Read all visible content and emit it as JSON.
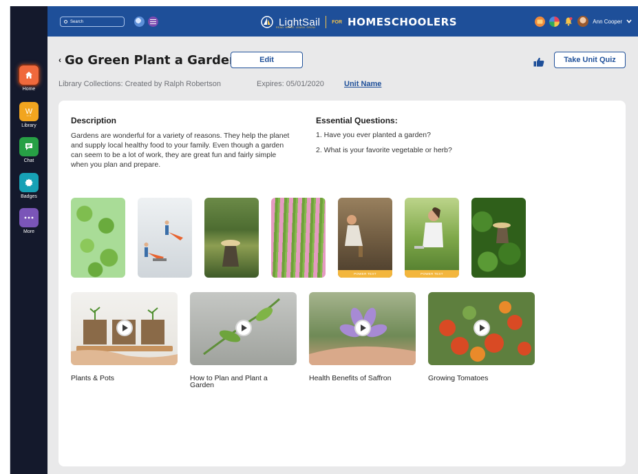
{
  "sidebar": {
    "items": [
      {
        "label": "Home",
        "icon": "home-icon",
        "color": "#f0693c"
      },
      {
        "label": "Library",
        "icon": "library-w-icon",
        "color": "#f2a51f"
      },
      {
        "label": "Chat",
        "icon": "chat-icon",
        "color": "#27a045"
      },
      {
        "label": "Badges",
        "icon": "badge-icon",
        "color": "#17a1b5"
      },
      {
        "label": "More",
        "icon": "more-dots-icon",
        "color": "#7a55b8"
      }
    ]
  },
  "header": {
    "search_placeholder": "Search",
    "logo_text": "LightSail",
    "logo_tagline": "READ. WRITE. LEARN. GROW.",
    "logo_for": "FOR",
    "logo_product": "HOMESCHOOLERS",
    "user_name": "Ann Cooper",
    "brand_color": "#1e4f99"
  },
  "page": {
    "back_glyph": "‹",
    "title": "Go Green Plant a Garden",
    "edit_label": "Edit",
    "quiz_label": "Take Unit Quiz",
    "collection": "Library Collections: Created by Ralph Robertson",
    "expires": "Expires: 05/01/2020",
    "unit_link": "Unit Name"
  },
  "content": {
    "description_heading": "Description",
    "description_text": "Gardens are wonderful for a variety of reasons. They help the planet and supply local healthy food to your family. Even though a garden can seem to be a lot of work, they are great fun and fairly simple when you plan and prepare.",
    "questions_heading": "Essential Questions:",
    "questions": [
      "1. Have you ever planted a garden?",
      "2. What is your favorite vegetable or herb?"
    ],
    "images": [
      {
        "subject": "broccoli",
        "power_text": ""
      },
      {
        "subject": "miniature-gardeners",
        "power_text": ""
      },
      {
        "subject": "rice-field-farmer",
        "power_text": ""
      },
      {
        "subject": "asparagus",
        "power_text": ""
      },
      {
        "subject": "man-planting",
        "power_text": "POWER TEXT"
      },
      {
        "subject": "woman-gardening",
        "power_text": "POWER TEXT"
      },
      {
        "subject": "farmer-in-leaves",
        "power_text": ""
      }
    ],
    "videos": [
      {
        "caption": "Plants & Pots"
      },
      {
        "caption": "How to Plan and Plant a Garden"
      },
      {
        "caption": "Health Benefits of Saffron"
      },
      {
        "caption": "Growing Tomatoes"
      }
    ]
  }
}
